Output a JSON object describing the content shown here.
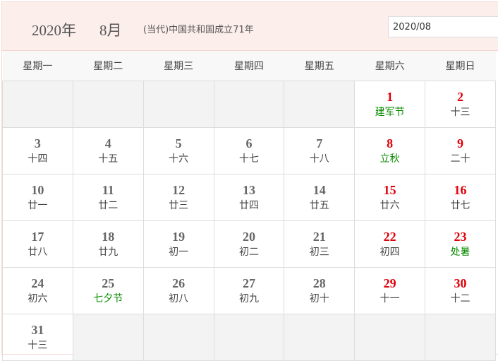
{
  "header": {
    "year": "2020年",
    "month": "8月",
    "note": "(当代)中国共和国成立71年",
    "date_input": "2020/08"
  },
  "weekdays": [
    "星期一",
    "星期二",
    "星期三",
    "星期四",
    "星期五",
    "星期六",
    "星期日"
  ],
  "weeks": [
    [
      null,
      null,
      null,
      null,
      null,
      {
        "day": "1",
        "lunar": "建军节",
        "red": true,
        "festival": true
      },
      {
        "day": "2",
        "lunar": "十三",
        "red": true
      }
    ],
    [
      {
        "day": "3",
        "lunar": "十四"
      },
      {
        "day": "4",
        "lunar": "十五"
      },
      {
        "day": "5",
        "lunar": "十六"
      },
      {
        "day": "6",
        "lunar": "十七"
      },
      {
        "day": "7",
        "lunar": "十八"
      },
      {
        "day": "8",
        "lunar": "立秋",
        "red": true,
        "festival": true
      },
      {
        "day": "9",
        "lunar": "二十",
        "red": true
      }
    ],
    [
      {
        "day": "10",
        "lunar": "廿一"
      },
      {
        "day": "11",
        "lunar": "廿二"
      },
      {
        "day": "12",
        "lunar": "廿三"
      },
      {
        "day": "13",
        "lunar": "廿四"
      },
      {
        "day": "14",
        "lunar": "廿五"
      },
      {
        "day": "15",
        "lunar": "廿六",
        "red": true
      },
      {
        "day": "16",
        "lunar": "廿七",
        "red": true
      }
    ],
    [
      {
        "day": "17",
        "lunar": "廿八"
      },
      {
        "day": "18",
        "lunar": "廿九"
      },
      {
        "day": "19",
        "lunar": "初一"
      },
      {
        "day": "20",
        "lunar": "初二"
      },
      {
        "day": "21",
        "lunar": "初三"
      },
      {
        "day": "22",
        "lunar": "初四",
        "red": true
      },
      {
        "day": "23",
        "lunar": "处暑",
        "red": true,
        "festival": true
      }
    ],
    [
      {
        "day": "24",
        "lunar": "初六"
      },
      {
        "day": "25",
        "lunar": "七夕节",
        "festival": true
      },
      {
        "day": "26",
        "lunar": "初八"
      },
      {
        "day": "27",
        "lunar": "初九"
      },
      {
        "day": "28",
        "lunar": "初十"
      },
      {
        "day": "29",
        "lunar": "十一",
        "red": true
      },
      {
        "day": "30",
        "lunar": "十二",
        "red": true
      }
    ],
    [
      {
        "day": "31",
        "lunar": "十三"
      },
      null,
      null,
      null,
      null,
      null,
      null
    ]
  ]
}
